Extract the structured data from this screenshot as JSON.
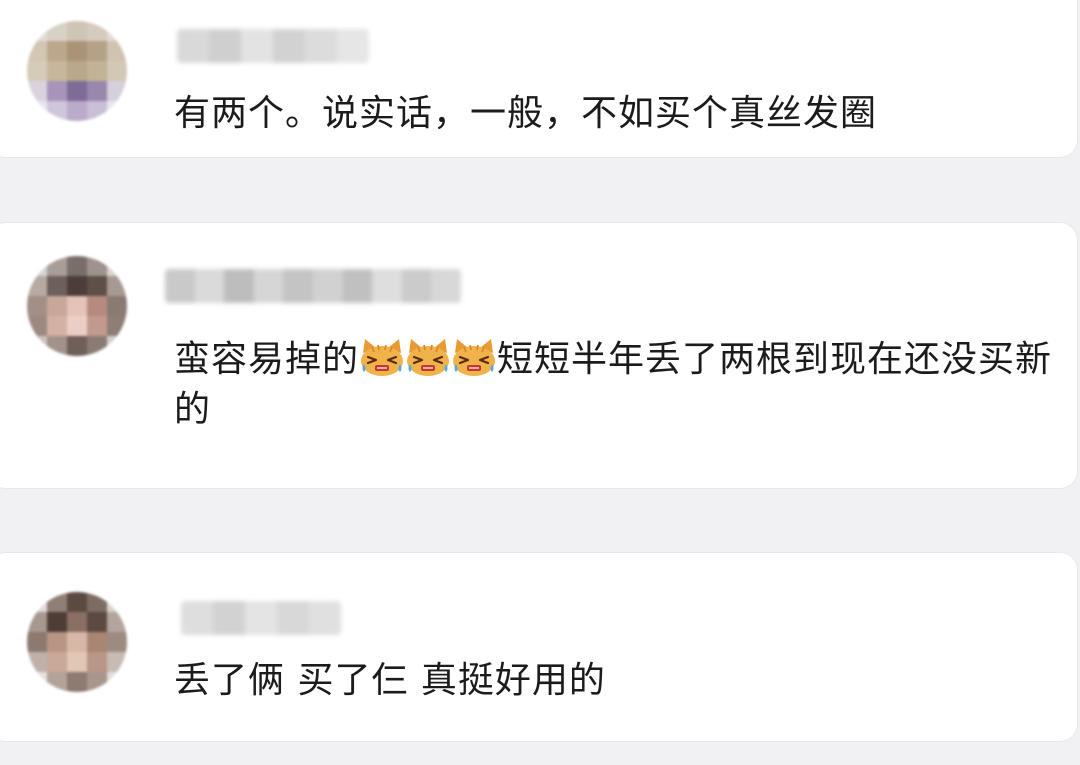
{
  "comments": [
    {
      "text_before": "有两个。说实话，一般，不如买个真丝发圈",
      "text_after": "",
      "emoji": []
    },
    {
      "text_before": "蛮容易掉的",
      "text_after": "短短半年丢了两根到现在还没买新的",
      "emoji": [
        "crying-cat-face",
        "crying-cat-face",
        "crying-cat-face"
      ]
    },
    {
      "text_before": "丢了俩 买了仨 真挺好用的",
      "text_after": "",
      "emoji": []
    }
  ],
  "colors": {
    "background": "#f1f1f3",
    "card": "#ffffff",
    "text": "#1b1b1b",
    "emoji_face": "#f0b24a",
    "emoji_tear": "#4fa8e8"
  }
}
